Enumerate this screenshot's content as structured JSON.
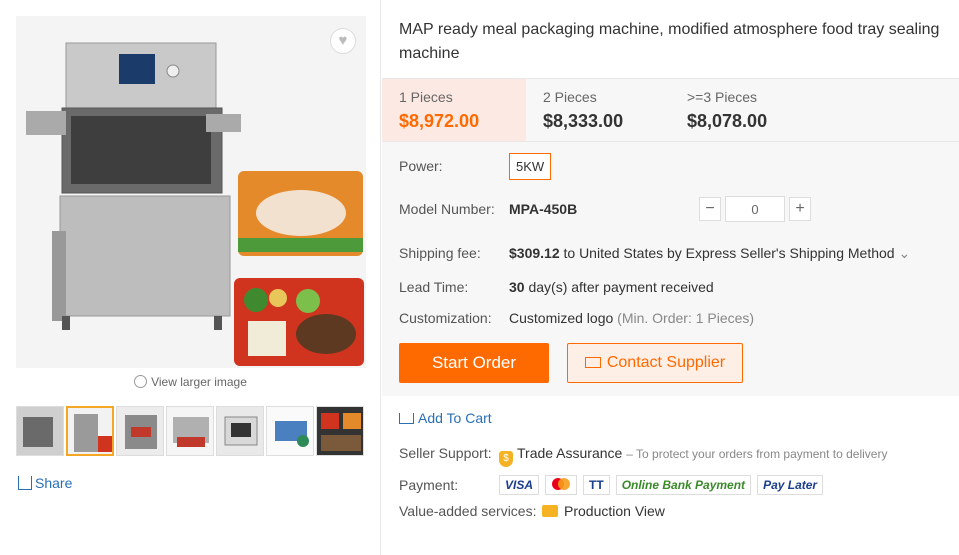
{
  "product": {
    "title": "MAP ready meal packaging machine, modified atmosphere food tray sealing machine"
  },
  "gallery": {
    "view_larger": "View larger image",
    "share": "Share"
  },
  "price_tiers": [
    {
      "qty": "1 Pieces",
      "price": "$8,972.00"
    },
    {
      "qty": "2 Pieces",
      "price": "$8,333.00"
    },
    {
      "qty": ">=3 Pieces",
      "price": "$8,078.00"
    }
  ],
  "attributes": {
    "power_label": "Power:",
    "power_option": "5KW",
    "model_label": "Model Number:",
    "model_value": "MPA-450B",
    "quantity_value": "0",
    "shipping_label": "Shipping fee:",
    "shipping_amount": "$309.12",
    "shipping_text": "to United States by Express Seller's Shipping Method",
    "lead_label": "Lead Time:",
    "lead_days": "30",
    "lead_text": "day(s) after payment received",
    "custom_label": "Customization:",
    "custom_value": "Customized logo",
    "custom_min": "(Min. Order: 1 Pieces)"
  },
  "actions": {
    "start_order": "Start Order",
    "contact_supplier": "Contact Supplier",
    "add_to_cart": "Add To Cart"
  },
  "seller": {
    "support_label": "Seller Support:",
    "trade_assurance": "Trade Assurance",
    "trade_note": "– To protect your orders from payment to delivery",
    "payment_label": "Payment:",
    "payments": [
      "VISA",
      "TT",
      "Online Bank Payment",
      "Pay Later"
    ],
    "vas_label": "Value-added services:",
    "production_view": "Production View"
  },
  "colors": {
    "accent": "#ff6a00",
    "link": "#2a6fb6"
  }
}
